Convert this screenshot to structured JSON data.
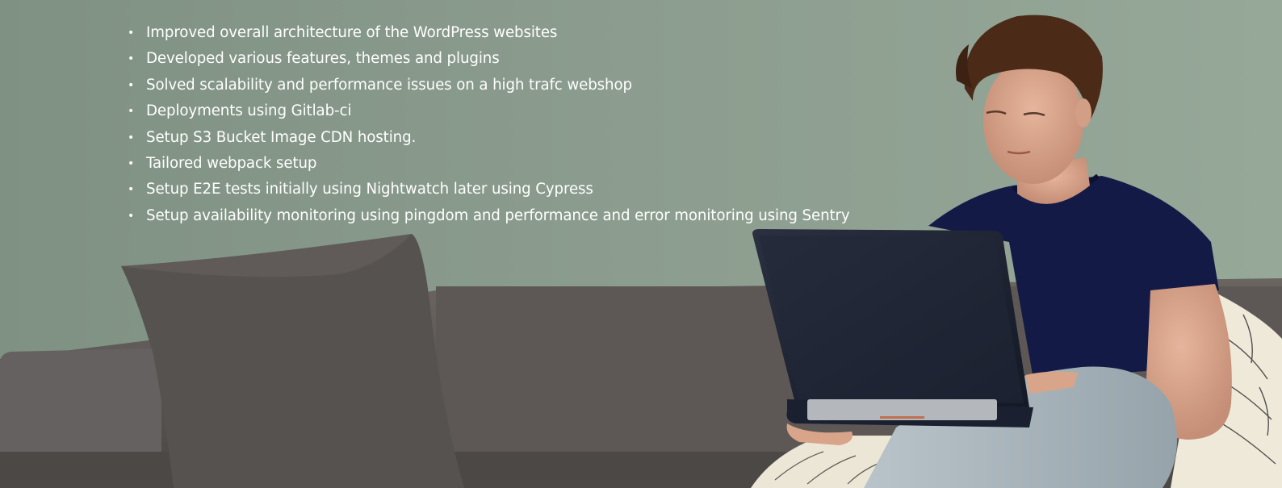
{
  "hero": {
    "image": "person-on-couch-with-laptop",
    "colors": {
      "wall": "#8fa190",
      "couch": "#5b5754",
      "pillow": "#55524f",
      "shirt": "#141a45",
      "laptop": "#1d2333",
      "jeans": "#a9b5bc",
      "text": "#ffffff"
    },
    "bullets": [
      {
        "text": "Improved overall architecture of the WordPress websites"
      },
      {
        "text": "Developed various features, themes and plugins"
      },
      {
        "text": "Solved scalability and performance issues on a high trafc webshop"
      },
      {
        "text": "Deployments using Gitlab-ci"
      },
      {
        "text": "Setup S3 Bucket Image CDN hosting."
      },
      {
        "text": "Tailored webpack setup"
      },
      {
        "text": "Setup E2E tests initially using Nightwatch later using Cypress"
      },
      {
        "text": "Setup availability monitoring using pingdom and performance and error monitoring using Sentry"
      }
    ]
  }
}
